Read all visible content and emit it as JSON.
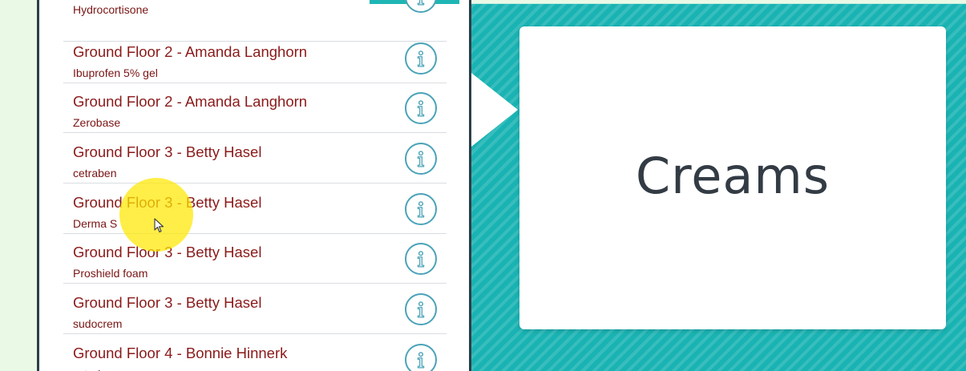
{
  "list": {
    "top_partial": {
      "subtitle": "Hydrocortisone"
    },
    "items": [
      {
        "title": "Ground Floor 2 - Amanda Langhorn",
        "subtitle": "Ibuprofen 5%  gel"
      },
      {
        "title": "Ground Floor 2 - Amanda Langhorn",
        "subtitle": "Zerobase"
      },
      {
        "title": "Ground Floor 3 - Betty Hasel",
        "subtitle": "cetraben"
      },
      {
        "title": "Ground Floor 3 - Betty Hasel",
        "subtitle": "Derma S"
      },
      {
        "title": "Ground Floor 3 - Betty Hasel",
        "subtitle": "Proshield foam"
      },
      {
        "title": "Ground Floor 3 - Betty Hasel",
        "subtitle": "sudocrem"
      },
      {
        "title": "Ground Floor 4 - Bonnie Hinnerk",
        "subtitle": "cetraben"
      }
    ],
    "item_icon": "info-icon"
  },
  "category": {
    "title": "Creams"
  },
  "colors": {
    "accent_teal": "#1ab3b3",
    "item_title": "#8b1a1a",
    "info_icon": "#4aa3b8",
    "panel_border": "#2c3e48",
    "background": "#eaf9e6"
  }
}
